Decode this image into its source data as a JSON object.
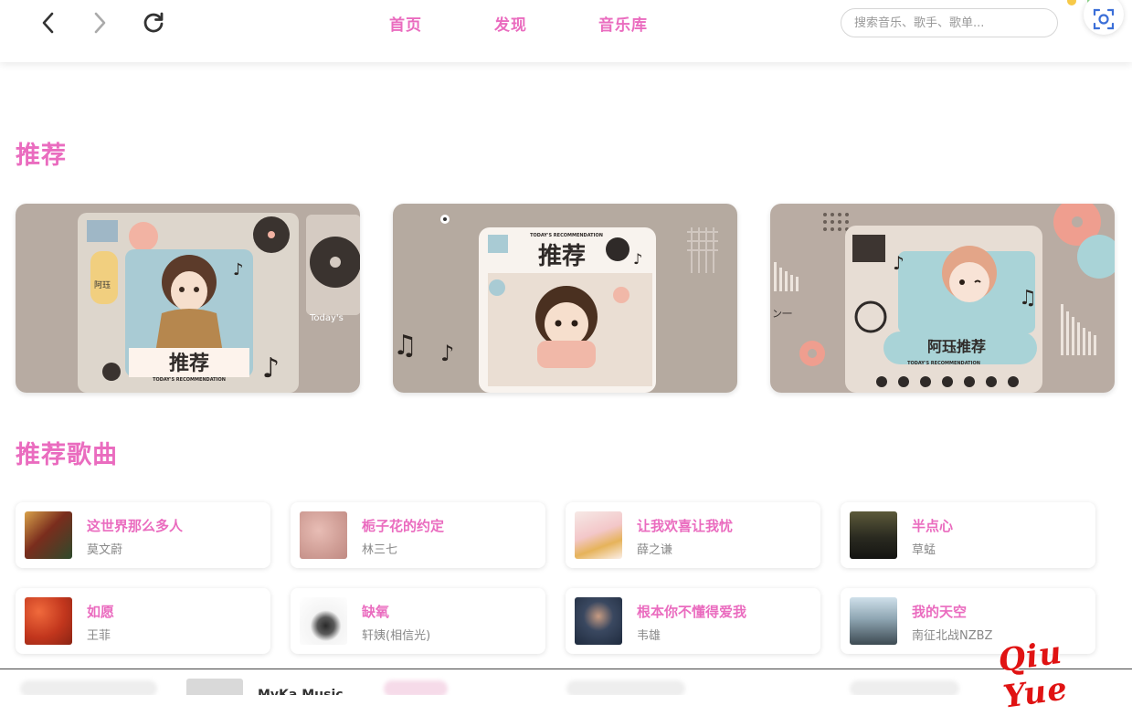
{
  "nav": {
    "tabs": [
      "首页",
      "发现",
      "音乐库"
    ],
    "search_placeholder": "搜索音乐、歌手、歌单..."
  },
  "sections": {
    "recommend_title": "推荐",
    "songs_title": "推荐歌曲"
  },
  "banners": [
    {
      "title": "推荐",
      "subtitle": "TODAY'S RECOMMENDATION",
      "side_text": "Today's",
      "tag": "阿珏"
    },
    {
      "title": "推荐",
      "subtitle": "TODAY'S RECOMMENDATION"
    },
    {
      "title": "阿珏推荐",
      "subtitle": "TODAY'S RECOMMENDATION",
      "side_text": "ン一"
    }
  ],
  "songs": [
    {
      "title": "这世界那么多人",
      "artist": "莫文蔚"
    },
    {
      "title": "栀子花的约定",
      "artist": "林三七"
    },
    {
      "title": "让我欢喜让我忧",
      "artist": "薛之谦"
    },
    {
      "title": "半点心",
      "artist": "草蜢"
    },
    {
      "title": "如愿",
      "artist": "王菲"
    },
    {
      "title": "缺氧",
      "artist": "轩姨(相信光)"
    },
    {
      "title": "根本你不懂得爱我",
      "artist": "韦雄"
    },
    {
      "title": "我的天空",
      "artist": "南征北战NZBZ"
    }
  ],
  "player": {
    "title": "MyKa Music"
  },
  "watermark": "Qiu Yue",
  "colors": {
    "accent": "#ea6cbf",
    "banner_bg": "#b7aba2"
  },
  "icons": {
    "back": "chevron-left-icon",
    "forward": "chevron-right-icon",
    "refresh": "refresh-icon",
    "scan": "scan-icon"
  }
}
